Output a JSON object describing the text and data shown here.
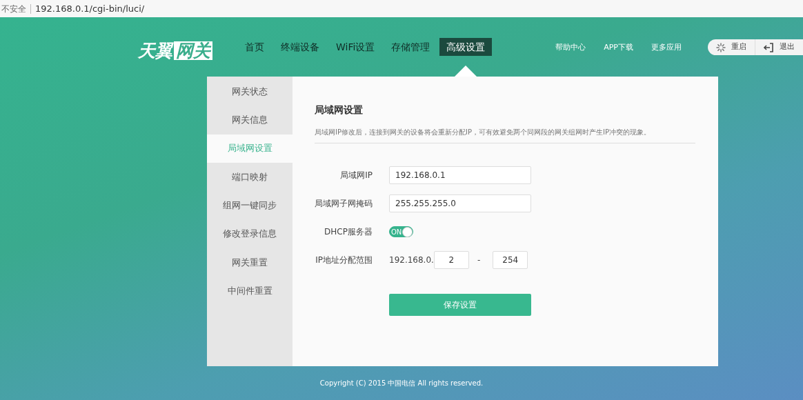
{
  "browser": {
    "security": "不安全",
    "url": "192.168.0.1/cgi-bin/luci/"
  },
  "logo": {
    "brand": "天翼",
    "product": "网关"
  },
  "nav": [
    {
      "label": "首页",
      "selected": false
    },
    {
      "label": "终端设备",
      "selected": false
    },
    {
      "label": "WiFi设置",
      "selected": false
    },
    {
      "label": "存储管理",
      "selected": false
    },
    {
      "label": "高级设置",
      "selected": true
    }
  ],
  "links": [
    "帮助中心",
    "APP下载",
    "更多应用"
  ],
  "actions": [
    {
      "kind": "restart",
      "label": "重启"
    },
    {
      "kind": "logout",
      "label": "退出"
    }
  ],
  "sidebar": [
    {
      "label": "网关状态",
      "selected": false
    },
    {
      "label": "网关信息",
      "selected": false
    },
    {
      "label": "局域网设置",
      "selected": true
    },
    {
      "label": "端口映射",
      "selected": false
    },
    {
      "label": "组网一键同步",
      "selected": false
    },
    {
      "label": "修改登录信息",
      "selected": false
    },
    {
      "label": "网关重置",
      "selected": false
    },
    {
      "label": "中间件重置",
      "selected": false
    }
  ],
  "section": {
    "title": "局域网设置",
    "description": "局域网IP修改后，连接到网关的设备将会重新分配IP，可有效避免两个同网段的网关组网时产生IP冲突的现象。"
  },
  "form": [
    {
      "kind": "text",
      "label": "局域网IP",
      "value": "192.168.0.1"
    },
    {
      "kind": "text",
      "label": "局域网子网掩码",
      "value": "255.255.255.0"
    },
    {
      "kind": "toggle",
      "label": "DHCP服务器",
      "on": true,
      "on_text": "ON"
    },
    {
      "kind": "range",
      "label": "IP地址分配范围",
      "prefix": "192.168.0.",
      "start": "2",
      "separator": "-",
      "end": "254"
    }
  ],
  "save_button": "保存设置",
  "footer": "Copyright (C) 2015 中国电信 All rights reserved."
}
